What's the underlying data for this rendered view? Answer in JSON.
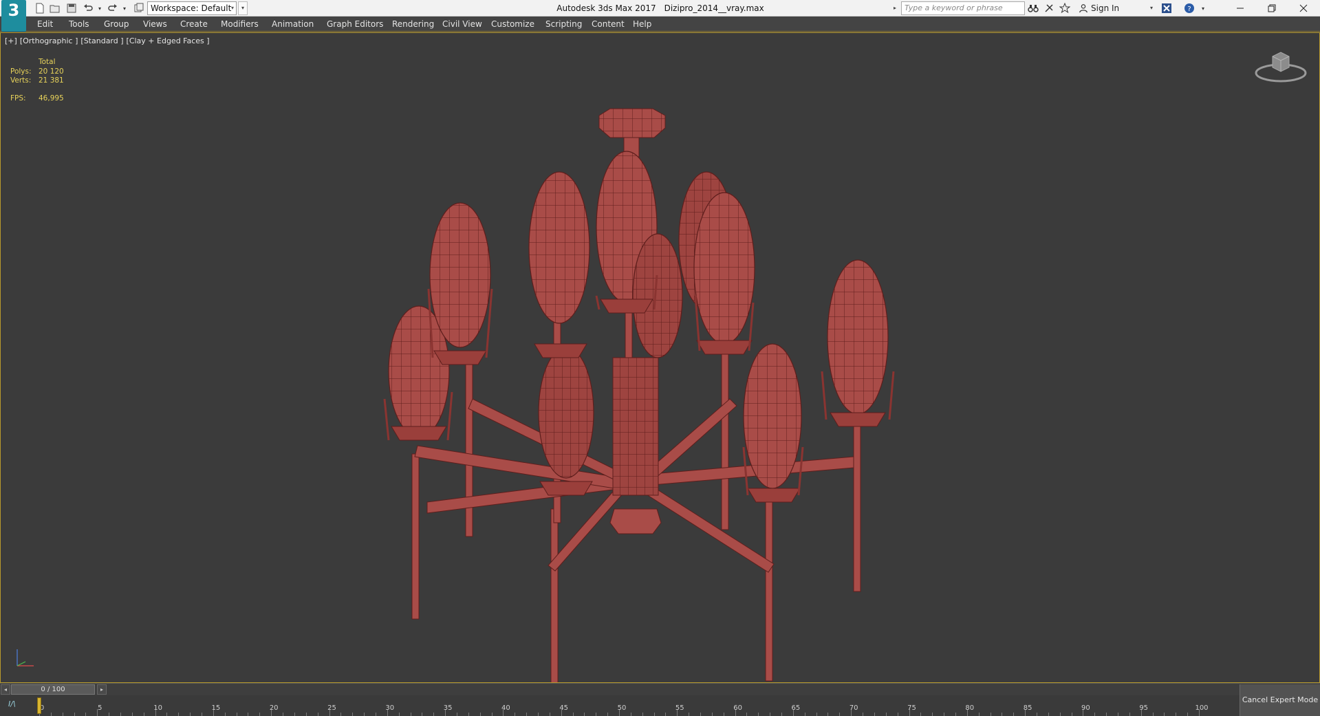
{
  "titlebar": {
    "workspace_label": "Workspace: Default",
    "app_name": "Autodesk 3ds Max 2017",
    "file_name": "Dizipro_2014__vray.max",
    "search_placeholder": "Type a keyword or phrase",
    "signin_label": "Sign In"
  },
  "menu": {
    "items": [
      "Edit",
      "Tools",
      "Group",
      "Views",
      "Create",
      "Modifiers",
      "Animation",
      "Graph Editors",
      "Rendering",
      "Civil View",
      "Customize",
      "Scripting",
      "Content",
      "Help"
    ]
  },
  "viewport": {
    "labels": [
      "[+]",
      "[Orthographic ]",
      "[Standard ]",
      "[Clay + Edged Faces ]"
    ],
    "stats": {
      "header": "Total",
      "polys_label": "Polys:",
      "polys_value": "20 120",
      "verts_label": "Verts:",
      "verts_value": "21 381",
      "fps_label": "FPS:",
      "fps_value": "46,995"
    },
    "model_color": "#a94c48",
    "edge_color": "#5e1e1c"
  },
  "timeslider": {
    "position_label": "0 / 100",
    "frame": 0,
    "total_frames": 100,
    "ticks": [
      "0",
      "5",
      "10",
      "15",
      "20",
      "25",
      "30",
      "35",
      "40",
      "45",
      "50",
      "55",
      "60",
      "65",
      "70",
      "75",
      "80",
      "85",
      "90",
      "95",
      "100"
    ]
  },
  "statusbar": {
    "cancel_expert_label": "Cancel Expert Mode"
  },
  "colors": {
    "viewport_border": "#b89a2c",
    "stats_text": "#e8d35a",
    "logo": "#1e8d9e"
  }
}
